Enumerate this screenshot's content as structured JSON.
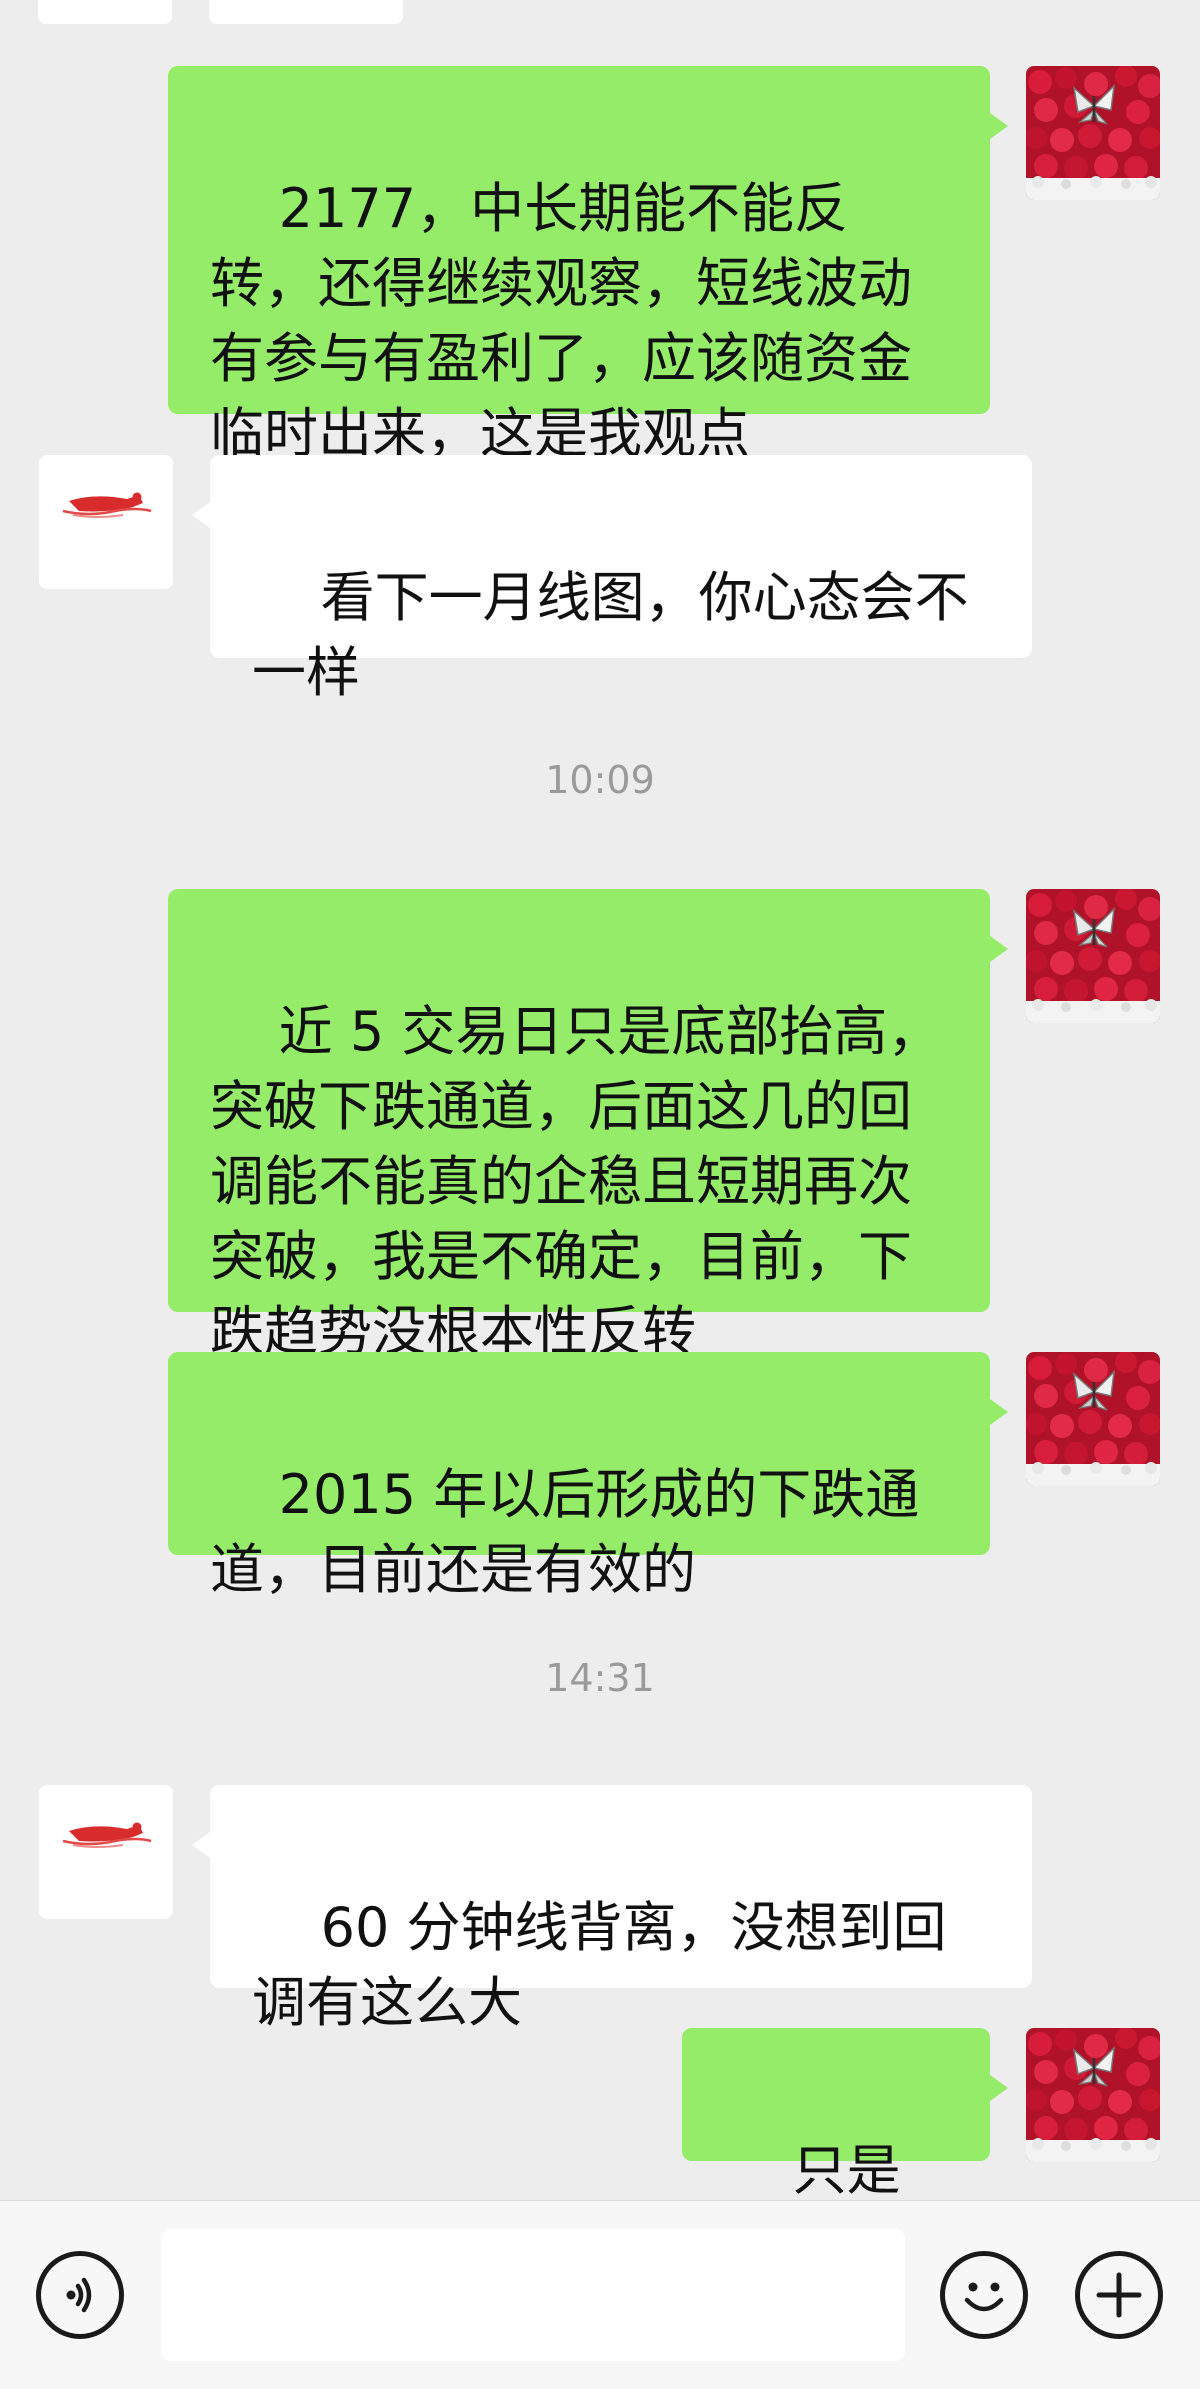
{
  "messages": [
    {
      "type": "text",
      "sender": "me",
      "text": "2177，中长期能不能反转，还得继续观察，短线波动有参与有盈利了，应该随资金临时出来，这是我观点"
    },
    {
      "type": "text",
      "sender": "other",
      "text": "看下一月线图，你心态会不一样"
    },
    {
      "type": "time",
      "text": "10:09"
    },
    {
      "type": "text",
      "sender": "me",
      "text": "近 5 交易日只是底部抬高，突破下跌通道，后面这几的回调能不能真的企稳且短期再次突破，我是不确定，目前，下跌趋势没根本性反转"
    },
    {
      "type": "text",
      "sender": "me",
      "text": "2015 年以后形成的下跌通道，目前还是有效的"
    },
    {
      "type": "time",
      "text": "14:31"
    },
    {
      "type": "text",
      "sender": "other",
      "text": "60 分钟线背离，没想到回调有这么大"
    },
    {
      "type": "text",
      "sender": "me",
      "text": "只是开始"
    }
  ],
  "colors": {
    "background": "#ededed",
    "my_bubble": "#95ec69",
    "their_bubble": "#ffffff",
    "timestamp": "#9a9a9a",
    "bottom_bar": "#f7f7f7"
  },
  "avatars": {
    "me": "red-roses-butterfly",
    "other": "red-swimmer-logo"
  },
  "input_bar": {
    "left_icon": "voice-icon",
    "input_value": "",
    "emoji_icon": "emoji-icon",
    "plus_icon": "plus-icon"
  }
}
